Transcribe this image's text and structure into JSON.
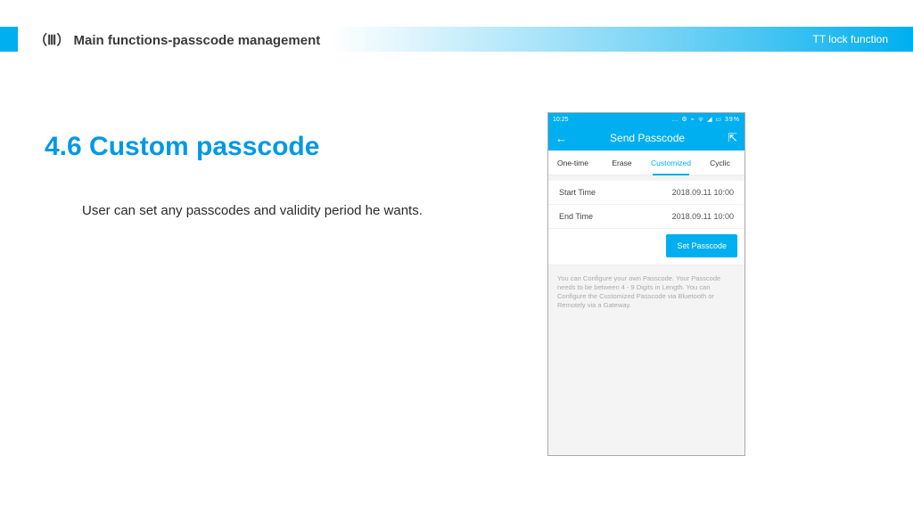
{
  "header": {
    "roman": "（Ⅲ）",
    "title": "Main functions-passcode management",
    "right": "TT lock function"
  },
  "section": {
    "title": "4.6 Custom passcode",
    "body": "User can set any passcodes and validity period he wants."
  },
  "phone": {
    "status": {
      "time": "10:25",
      "icons": "… ⚙ ⌁ ᯤ ◢ ▭ 39%"
    },
    "appbar": {
      "back": "←",
      "title": "Send Passcode",
      "share": "⇱"
    },
    "tabs": {
      "items": [
        "One-time",
        "Erase",
        "Customized",
        "Cyclic"
      ],
      "activeIndex": 2
    },
    "form": {
      "startLabel": "Start Time",
      "startValue": "2018.09.11 10:00",
      "endLabel": "End Time",
      "endValue": "2018.09.11 10:00",
      "button": "Set Passcode"
    },
    "hint": "You can Configure your own Passcode. Your Passcode needs to be between 4 - 9 Digits in Length. You can Configure the Customized Passcode via Bluetooth or Remotely via a Gateway."
  }
}
